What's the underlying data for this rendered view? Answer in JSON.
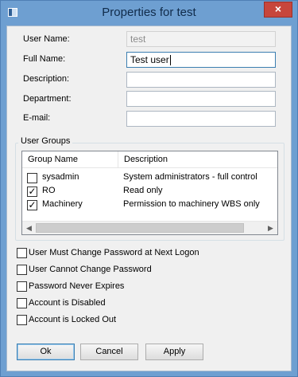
{
  "window": {
    "title": "Properties for test",
    "close_glyph": "×"
  },
  "fields": {
    "user_name_label": "User Name:",
    "user_name_value": "test",
    "full_name_label": "Full Name:",
    "full_name_value": "Test user",
    "description_label": "Description:",
    "description_value": "",
    "department_label": "Department:",
    "department_value": "",
    "email_label": "E-mail:",
    "email_value": ""
  },
  "user_groups": {
    "title": "User Groups",
    "columns": [
      "Group Name",
      "Description"
    ],
    "rows": [
      {
        "name": "sysadmin",
        "description": "System administrators - full control",
        "checked": false
      },
      {
        "name": "RO",
        "description": "Read only",
        "checked": true
      },
      {
        "name": "Machinery",
        "description": "Permission to machinery WBS only",
        "checked": true
      }
    ],
    "scroll_left_glyph": "◀",
    "scroll_right_glyph": "▶"
  },
  "options": [
    {
      "label": "User Must Change Password at Next Logon",
      "checked": false
    },
    {
      "label": "User Cannot Change Password",
      "checked": false
    },
    {
      "label": "Password Never Expires",
      "checked": false
    },
    {
      "label": "Account is Disabled",
      "checked": false
    },
    {
      "label": "Account is Locked Out",
      "checked": false
    }
  ],
  "buttons": {
    "ok": "Ok",
    "cancel": "Cancel",
    "apply": "Apply"
  },
  "check_glyph": "✓",
  "colors": {
    "titlebar": "#6e9fd1",
    "close_button": "#c7463c",
    "dialog_bg": "#f0f0f0",
    "default_button_border": "#3c7fb1"
  }
}
